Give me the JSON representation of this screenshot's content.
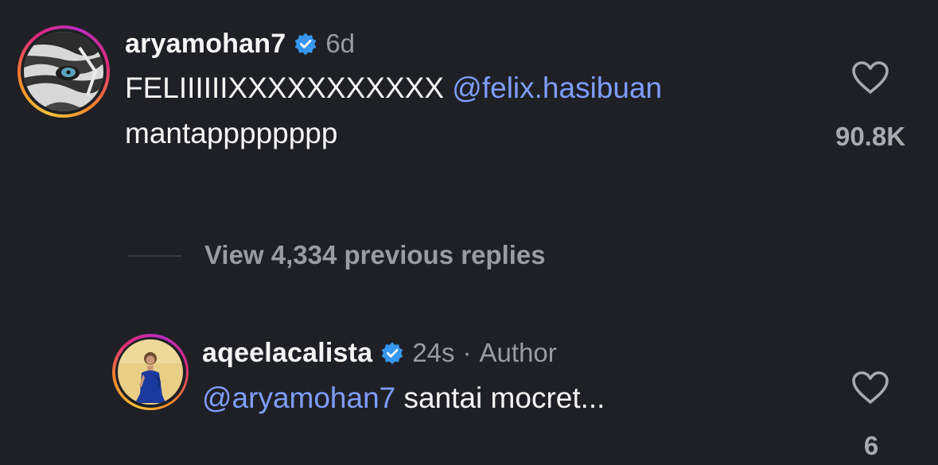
{
  "comment": {
    "username": "aryamohan7",
    "age": "6d",
    "text_line1_prefix": "FELIIIIIIXXXXXXXXXXX",
    "mention": "@felix.hasibuan",
    "text_line2": "mantapppppppp",
    "like_count": "90.8K"
  },
  "view_replies": {
    "label": "View 4,334 previous replies"
  },
  "reply": {
    "username": "aqeelacalista",
    "age": "24s",
    "separator": "·",
    "badge": "Author",
    "mention": "@aryamohan7",
    "text": "santai mocret...",
    "like_count": "6"
  },
  "colors": {
    "background": "#1f2025",
    "mention": "#7f9dff",
    "verified": "#3797f0",
    "muted_text": "#9a9ba3"
  },
  "icons": {
    "verified": "verified-badge-icon",
    "like": "heart-outline-icon"
  }
}
